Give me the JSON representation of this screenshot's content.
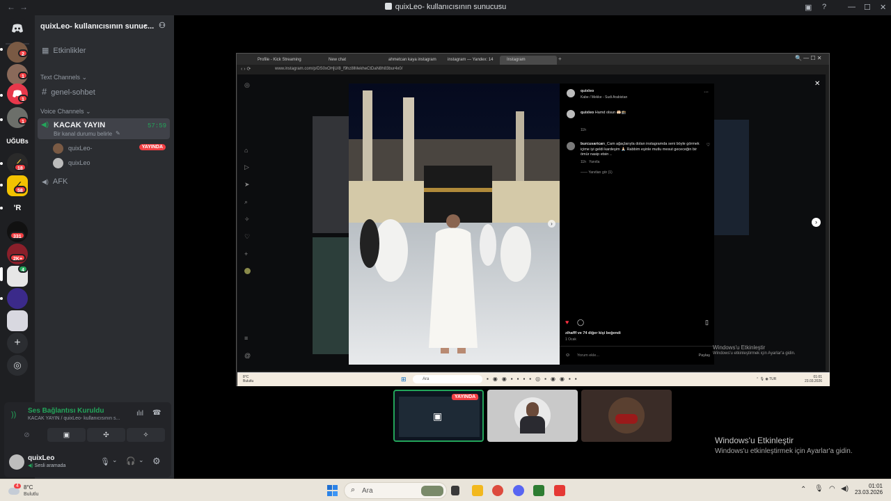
{
  "window": {
    "title": "quixLeo- kullanıcısının sunucusu"
  },
  "server": {
    "name": "quixLeo- kullanıcısının sunuc..."
  },
  "sidebar": {
    "events_label": "Etkinlikler",
    "text_category": "Text Channels",
    "text_channels": [
      "genel-sohbet"
    ],
    "voice_category": "Voice Channels",
    "voice_channel": {
      "name": "KACAK YAYIN",
      "timer": "57:59",
      "status": "Bir kanal durumu belirle"
    },
    "voice_members": [
      {
        "name": "quixLeo-",
        "badge": "YAYINDA"
      },
      {
        "name": "quixLeo"
      }
    ],
    "afk_channel": "AFK"
  },
  "rail": {
    "badges": [
      "2",
      "1",
      "1",
      "1",
      "18",
      "58",
      "331",
      "2K+",
      "4"
    ],
    "labels": [
      "UĞUBs",
      "'R"
    ]
  },
  "voice_panel": {
    "status": "Ses Bağlantısı Kuruldu",
    "channel": "KACAK YAYIN / quixLeo- kullanıcısının s..."
  },
  "user_panel": {
    "name": "quixLeo",
    "status": "Sesli aramada"
  },
  "browser": {
    "tabs": [
      "Profile - Kick Streaming",
      "New chat",
      "ahmetcan kaya instagram",
      "instagram — Yandex: 14",
      "Instagram"
    ],
    "address": "www.instagram.com/p/DS0xOHjU/8_f9hz8lMekheCtDaN8h83bur4x0/"
  },
  "instagram": {
    "user": "quixleo",
    "location": "Kabe / Mekke - Sudi Arabistan",
    "caption": "Hamd olsun 🤲🏻🕋",
    "caption_time": "11h",
    "comment_user": "burcusaricarı_",
    "comment_text": "Cam ağaçlarıyla dolan instagramda seni böyle görmek içime iyi geldi kardeşim 🙏🏻 Rabbim eşinle mutlu mesut gececeğin bir ömür nasip etsin ..",
    "comment_time": "11h",
    "comment_reply": "Yanıtla",
    "view_replies": "Yanıtları gör (1)",
    "likes": "zihafff ve 74 diğer kişi beğendi",
    "date": "1 Ocak",
    "add_comment": "Yorum ekle...",
    "share": "Paylaş"
  },
  "inner_taskbar": {
    "search": "Ara",
    "weather": "8°C",
    "weather_sub": "Bulutlu",
    "lang": "TUR",
    "time": "01:01",
    "date": "23.03.2026"
  },
  "tiles": {
    "badge": "YAYINDA"
  },
  "watermark": {
    "title": "Windows'u Etkinleştir",
    "sub": "Windows'u etkinleştirmek için Ayarlar'a gidin."
  },
  "taskbar": {
    "weather_temp": "8°C",
    "weather_desc": "Bulutlu",
    "weather_badge": "4",
    "search": "Ara",
    "time": "01:01",
    "date": "23.03.2026"
  },
  "colors": {
    "discord_bg": "#1e1f22",
    "sidebar": "#2b2d31",
    "green": "#23a55a",
    "red": "#f23f43",
    "accent": "#5865f2"
  }
}
